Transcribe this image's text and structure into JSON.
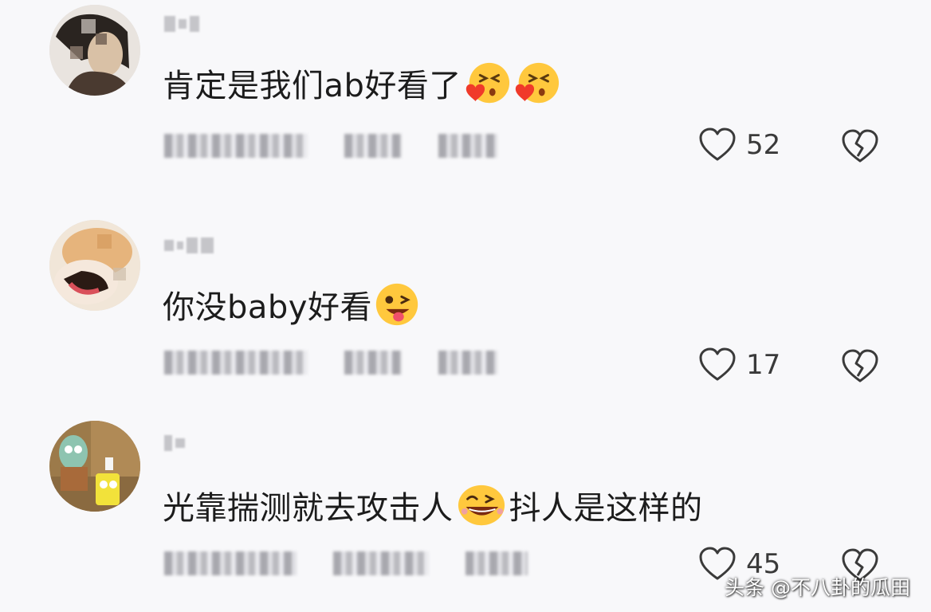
{
  "comments": [
    {
      "text_before": "肯定是我们ab好看了",
      "emojis_after": [
        "kissing-heart-emoji",
        "kissing-heart-emoji"
      ],
      "likes": "52",
      "avatar_colors": [
        "#3a2a20",
        "#d8c0a8"
      ]
    },
    {
      "text_before": "你没baby好看",
      "emojis_after": [
        "winking-tongue-emoji"
      ],
      "likes": "17",
      "avatar_colors": [
        "#e8c8a0",
        "#3a2a20"
      ]
    },
    {
      "text_before": "光靠揣测就去攻击人",
      "emojis_middle": [
        "grinning-wink-emoji"
      ],
      "text_after": "抖人是这样的",
      "likes": "45",
      "avatar_colors": [
        "#a08050",
        "#6a9a8a"
      ]
    }
  ],
  "watermark": "头条 @不八卦的瓜田",
  "colors": {
    "background": "#f8f8fa",
    "text": "#1c1c1c",
    "icon_outline": "#3a3a3a"
  }
}
